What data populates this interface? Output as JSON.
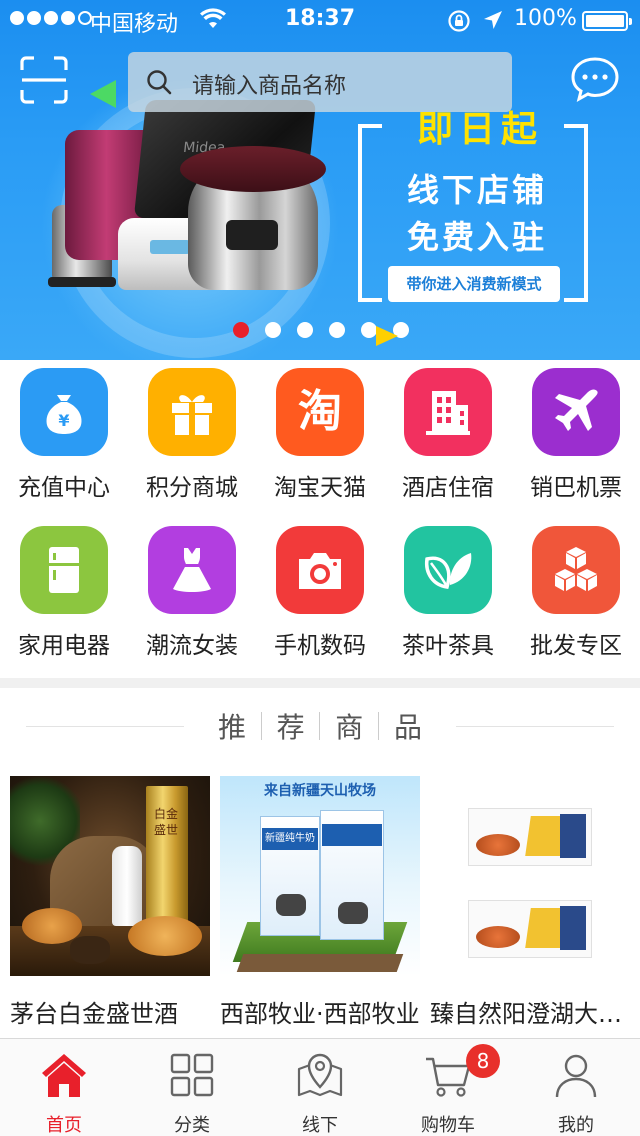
{
  "status_bar": {
    "carrier": "中国移动",
    "time": "18:37",
    "battery": "100%"
  },
  "header": {
    "search_placeholder": "请输入商品名称",
    "scan_icon": "scan-icon",
    "message_icon": "chat-bubble-icon"
  },
  "banner": {
    "headline": "即日起",
    "line1": "线下店铺",
    "line2": "免费入驻",
    "tag": "带你进入消费新模式",
    "brand_on_device": "Midea",
    "slide_count": 6,
    "active_slide": 1
  },
  "categories": [
    {
      "label": "充值中心",
      "icon": "money-bag-icon",
      "color": "#2b9bf4"
    },
    {
      "label": "积分商城",
      "icon": "gift-icon",
      "color": "#ffb000"
    },
    {
      "label": "淘宝天猫",
      "icon": "taobao-icon",
      "glyph": "淘",
      "color": "#ff5a1f"
    },
    {
      "label": "酒店住宿",
      "icon": "building-icon",
      "color": "#f2305f"
    },
    {
      "label": "销巴机票",
      "icon": "airplane-icon",
      "color": "#9b2ecf"
    },
    {
      "label": "家用电器",
      "icon": "fridge-icon",
      "color": "#8cc63f"
    },
    {
      "label": "潮流女装",
      "icon": "dress-icon",
      "color": "#b23ee0"
    },
    {
      "label": "手机数码",
      "icon": "camera-icon",
      "color": "#f23a3a"
    },
    {
      "label": "茶叶茶具",
      "icon": "tea-leaf-icon",
      "color": "#22c4a0"
    },
    {
      "label": "批发专区",
      "icon": "boxes-icon",
      "color": "#f0563a"
    }
  ],
  "recommended": {
    "title_chars": [
      "推",
      "荐",
      "商",
      "品"
    ],
    "products": [
      {
        "name": "茅台白金盛世酒",
        "bottle_text": "白金盛世"
      },
      {
        "name": "西部牧业·西部牧业",
        "banner_text": "来自新疆天山牧场",
        "carton_text": "新疆纯牛奶"
      },
      {
        "name": "臻自然阳澄湖大闸蟹"
      }
    ]
  },
  "tabbar": {
    "tabs": [
      {
        "label": "首页",
        "icon": "home-icon",
        "active": true
      },
      {
        "label": "分类",
        "icon": "grid-icon",
        "active": false
      },
      {
        "label": "线下",
        "icon": "map-pin-icon",
        "active": false
      },
      {
        "label": "购物车",
        "icon": "cart-icon",
        "active": false
      },
      {
        "label": "我的",
        "icon": "user-icon",
        "active": false
      }
    ],
    "cart_badge": "8"
  },
  "colors": {
    "accent_red": "#e8202b",
    "banner_blue": "#2a9cf5",
    "ad_yellow": "#ffe200"
  }
}
